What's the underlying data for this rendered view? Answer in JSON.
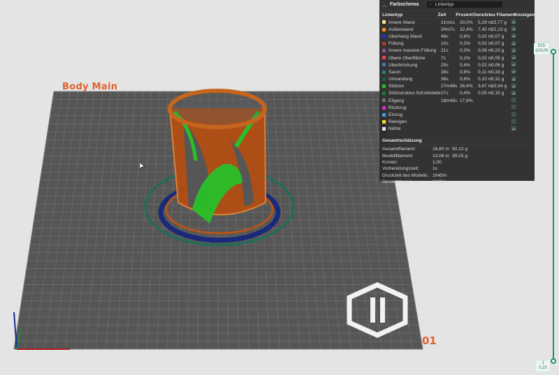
{
  "viewport": {
    "plate_label": "Body Main",
    "plate_number": "01"
  },
  "panel": {
    "title": "Farbschema",
    "selector_value": "Linientyp",
    "headers": {
      "line_type": "Linientyp",
      "time": "Zeit",
      "percent": "Prozent",
      "used_filament": "Genutztes Filament",
      "display": "Anzeigen"
    },
    "rows": [
      {
        "name": "Innere Wand",
        "color": "#ffe680",
        "time": "21m1s",
        "percent": "20,0%",
        "length": "5,29 m",
        "weight": "15,77 g",
        "visible": true
      },
      {
        "name": "Außenwand",
        "color": "#ff8c1a",
        "time": "34m7s",
        "percent": "32,4%",
        "length": "7,42 m",
        "weight": "22,13 g",
        "visible": true
      },
      {
        "name": "Überhang Wand",
        "color": "#1f33c7",
        "time": "48s",
        "percent": "0,8%",
        "length": "0,02 m",
        "weight": "0,07 g",
        "visible": true
      },
      {
        "name": "Füllung",
        "color": "#b33a2e",
        "time": "10s",
        "percent": "0,2%",
        "length": "0,02 m",
        "weight": "0,07 g",
        "visible": true
      },
      {
        "name": "Innere massive Füllung",
        "color": "#9a4f9a",
        "time": "21s",
        "percent": "0,3%",
        "length": "0,08 m",
        "weight": "0,23 g",
        "visible": true
      },
      {
        "name": "Obere Oberfläche",
        "color": "#e04848",
        "time": "7s",
        "percent": "0,1%",
        "length": "0,02 m",
        "weight": "0,05 g",
        "visible": true
      },
      {
        "name": "Überbrückung",
        "color": "#4f6fa8",
        "time": "25s",
        "percent": "0,4%",
        "length": "0,02 m",
        "weight": "0,06 g",
        "visible": true
      },
      {
        "name": "Saum",
        "color": "#1f8080",
        "time": "39s",
        "percent": "0,6%",
        "length": "0,11 m",
        "weight": "0,33 g",
        "visible": true
      },
      {
        "name": "Umrandung",
        "color": "#1d5c4a",
        "time": "36s",
        "percent": "0,6%",
        "length": "0,10 m",
        "weight": "0,31 g",
        "visible": true
      },
      {
        "name": "Stützen",
        "color": "#22c322",
        "time": "27m49s",
        "percent": "26,4%",
        "length": "3,67 m",
        "weight": "10,94 g",
        "visible": true
      },
      {
        "name": "Stützstruktur-Schnittstelle",
        "color": "#1a7f30",
        "time": "27s",
        "percent": "0,4%",
        "length": "0,05 m",
        "weight": "0,15 g",
        "visible": true
      },
      {
        "name": "Eilgang",
        "color": "#707070",
        "time": "18m45s",
        "percent": "17,8%",
        "length": "",
        "weight": "",
        "visible": false
      },
      {
        "name": "Rückzug",
        "color": "#d030d0",
        "time": "",
        "percent": "",
        "length": "",
        "weight": "",
        "visible": false
      },
      {
        "name": "Einzug",
        "color": "#3aa0e0",
        "time": "",
        "percent": "",
        "length": "",
        "weight": "",
        "visible": false
      },
      {
        "name": "Reinigen",
        "color": "#f0e020",
        "time": "",
        "percent": "",
        "length": "",
        "weight": "",
        "visible": false
      },
      {
        "name": "Nähte",
        "color": "#e8e8e8",
        "time": "",
        "percent": "",
        "length": "",
        "weight": "",
        "visible": true
      }
    ],
    "summary_title": "Gesamtschätzung",
    "summary": [
      {
        "label": "Gesamtfilament:",
        "v1": "16,80 m",
        "v2": "50,12 g"
      },
      {
        "label": "Modellfilament:",
        "v1": "13,08 m",
        "v2": "39,03 g"
      },
      {
        "label": "Kosten:",
        "v1": "1,00",
        "v2": ""
      },
      {
        "label": "Vorbereitungszeit:",
        "v1": "1s",
        "v2": ""
      },
      {
        "label": "Druckzeit des Modells:",
        "v1": "1h45m",
        "v2": ""
      },
      {
        "label": "Gesamtdauer:",
        "v1": "1h45m",
        "v2": ""
      }
    ]
  },
  "layer_slider": {
    "top_layer": "515",
    "top_height": "103,00",
    "bottom_layer": "1",
    "bottom_height": "0,20"
  }
}
